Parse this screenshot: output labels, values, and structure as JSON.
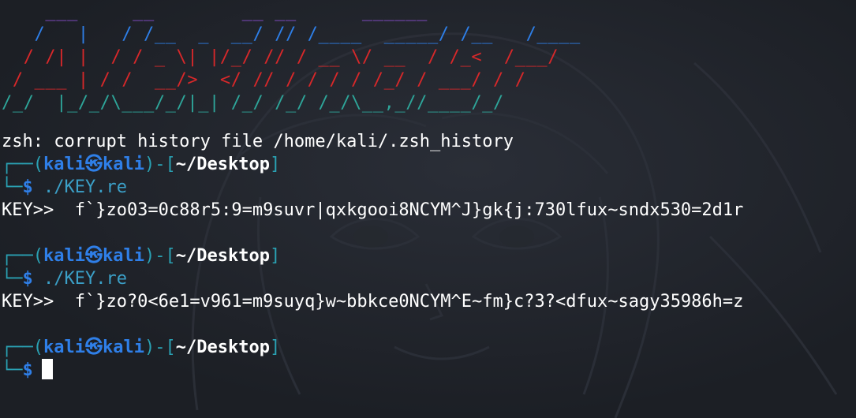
{
  "banner": {
    "line1": "    ___     __        __ __      ______",
    "line2": "   /   |   / /__  _  __/ // /____  _____/ /__   /____",
    "line3": "  / /| |  / / _ \\| |/_/ // / __ \\/ __  / /_<  /___/",
    "line4": " / ___ | / /  __/>  </ // / / / / /_/ / ___/ / /",
    "line5": "/_/  |_/_/\\___/_/|_| /_/ /_/ /_/\\__,_//____/_/"
  },
  "terminal": {
    "error_line": "zsh: corrupt history file /home/kali/.zsh_history",
    "frame_top": "┌──",
    "frame_bottom": "└─",
    "prompt_user": "kali",
    "prompt_at": "㉿",
    "prompt_host": "kali",
    "prompt_path": "~/Desktop",
    "prompt_symbol": "$",
    "commands": [
      {
        "cmd": "./KEY.re",
        "output": "KEY>>  f`}zo03=0c88r5:9=m9suvr|qxkgooi8NCYM^J}gk{j:730lfux~sndx530=2d1r"
      },
      {
        "cmd": "./KEY.re",
        "output": "KEY>>  f`}zo?0<6e1=v961=m9suyq}w~bbkce0NCYM^E~fm}c?3?<dfux~sagy35986h=z"
      }
    ]
  },
  "colors": {
    "background": "#1e2128",
    "user": "#2f7fe8",
    "frame": "#2aa1b3",
    "command": "#3ba0c8",
    "banner_purple": "#8a4fd0",
    "banner_blue": "#2e7fe8",
    "banner_red": "#d8282a",
    "banner_teal": "#2ea69a"
  }
}
